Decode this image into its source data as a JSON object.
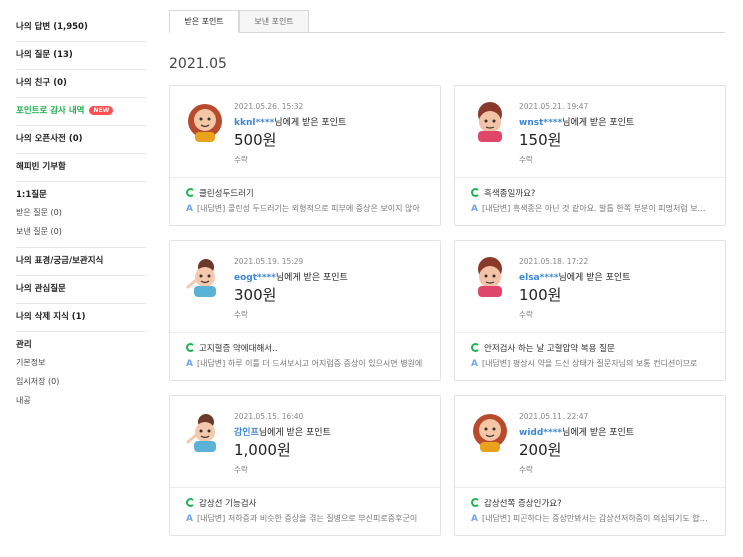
{
  "sidebar": {
    "groups": [
      {
        "items": [
          {
            "label": "나의 답변 (1,950)"
          }
        ]
      },
      {
        "items": [
          {
            "label": "나의 질문 (13)"
          }
        ]
      },
      {
        "items": [
          {
            "label": "나의 친구 (0)"
          }
        ]
      },
      {
        "items": [
          {
            "label": "포인트로 감사 내역",
            "badge": "NEW"
          }
        ]
      },
      {
        "items": [
          {
            "label": "나의 오픈사전 (0)"
          }
        ]
      },
      {
        "items": [
          {
            "label": "해피빈 기부함"
          }
        ]
      },
      {
        "title": "1:1질문",
        "subs": [
          "받은 질문 (0)",
          "보낸 질문 (0)"
        ]
      },
      {
        "items": [
          {
            "label": "나의 표경/궁금/보관지식"
          }
        ]
      },
      {
        "items": [
          {
            "label": "나의 관심질문"
          }
        ]
      },
      {
        "items": [
          {
            "label": "나의 삭제 지식 (1)"
          }
        ]
      },
      {
        "title": "관리",
        "subs": [
          "기본정보",
          "임시저장 (0)",
          "내공"
        ]
      }
    ]
  },
  "tabs": {
    "received": "받은 포인트",
    "sent": "보낸 포인트"
  },
  "month": "2021.05",
  "cards": [
    {
      "date": "2021.05.26. 15:32",
      "user": "kknl****",
      "suffix": "님에게 받은 포인트",
      "points": "500원",
      "status": "수락",
      "question": "클린성두드러기",
      "answer": "[내답변] 콜린성 두드러기는 외형적으로 피부에 증상은 보이지 않아",
      "avatar": "bald-red"
    },
    {
      "date": "2021.05.21. 19:47",
      "user": "wnst****",
      "suffix": "님에게 받은 포인트",
      "points": "150원",
      "status": "수락",
      "question": "흑색종일까요?",
      "answer": "[내답변] 흑색종은 아닌 것 같아요. 발톱 한쪽 부분이 피멍처럼 보이네요",
      "avatar": "curly-pink"
    },
    {
      "date": "2021.05.19. 15:29",
      "user": "eogt****",
      "suffix": "님에게 받은 포인트",
      "points": "300원",
      "status": "수락",
      "question": "고지혈증 약에대해서..",
      "answer": "[내답변] 하루 이틀 더 드셔보시고 어지럼증 증상이 있으시면 병원에",
      "avatar": "girl-blue"
    },
    {
      "date": "2021.05.18. 17:22",
      "user": "elsa****",
      "suffix": "님에게 받은 포인트",
      "points": "100원",
      "status": "수락",
      "question": "안저검사 하는 날 고혈압약 복용 질문",
      "answer": "[내답변] 평상시 약을 드신 상태가 질문자님의 보통 컨디션이므로",
      "avatar": "curly-pink"
    },
    {
      "date": "2021.05.15. 16:40",
      "user": "감인프",
      "suffix": "님에게 받은 포인트",
      "points": "1,000원",
      "status": "수락",
      "question": "갑상선 기능검사",
      "answer": "[내답변] 저하증과 비슷한 증상을 겪는 질병으로 부신피로증후군이",
      "avatar": "girl-blue"
    },
    {
      "date": "2021.05.11. 22:47",
      "user": "widd****",
      "suffix": "님에게 받은 포인트",
      "points": "200원",
      "status": "수락",
      "question": "갑상선쪽 증상인가요?",
      "answer": "[내답변] 피곤하다는 증상만봐서는 갑상선저하증이 의심되기도 합니다",
      "avatar": "bald-red"
    }
  ],
  "colors": {
    "accent_green": "#19b04b",
    "user_blue": "#3b86d8",
    "badge_red": "#ff4f4f"
  }
}
